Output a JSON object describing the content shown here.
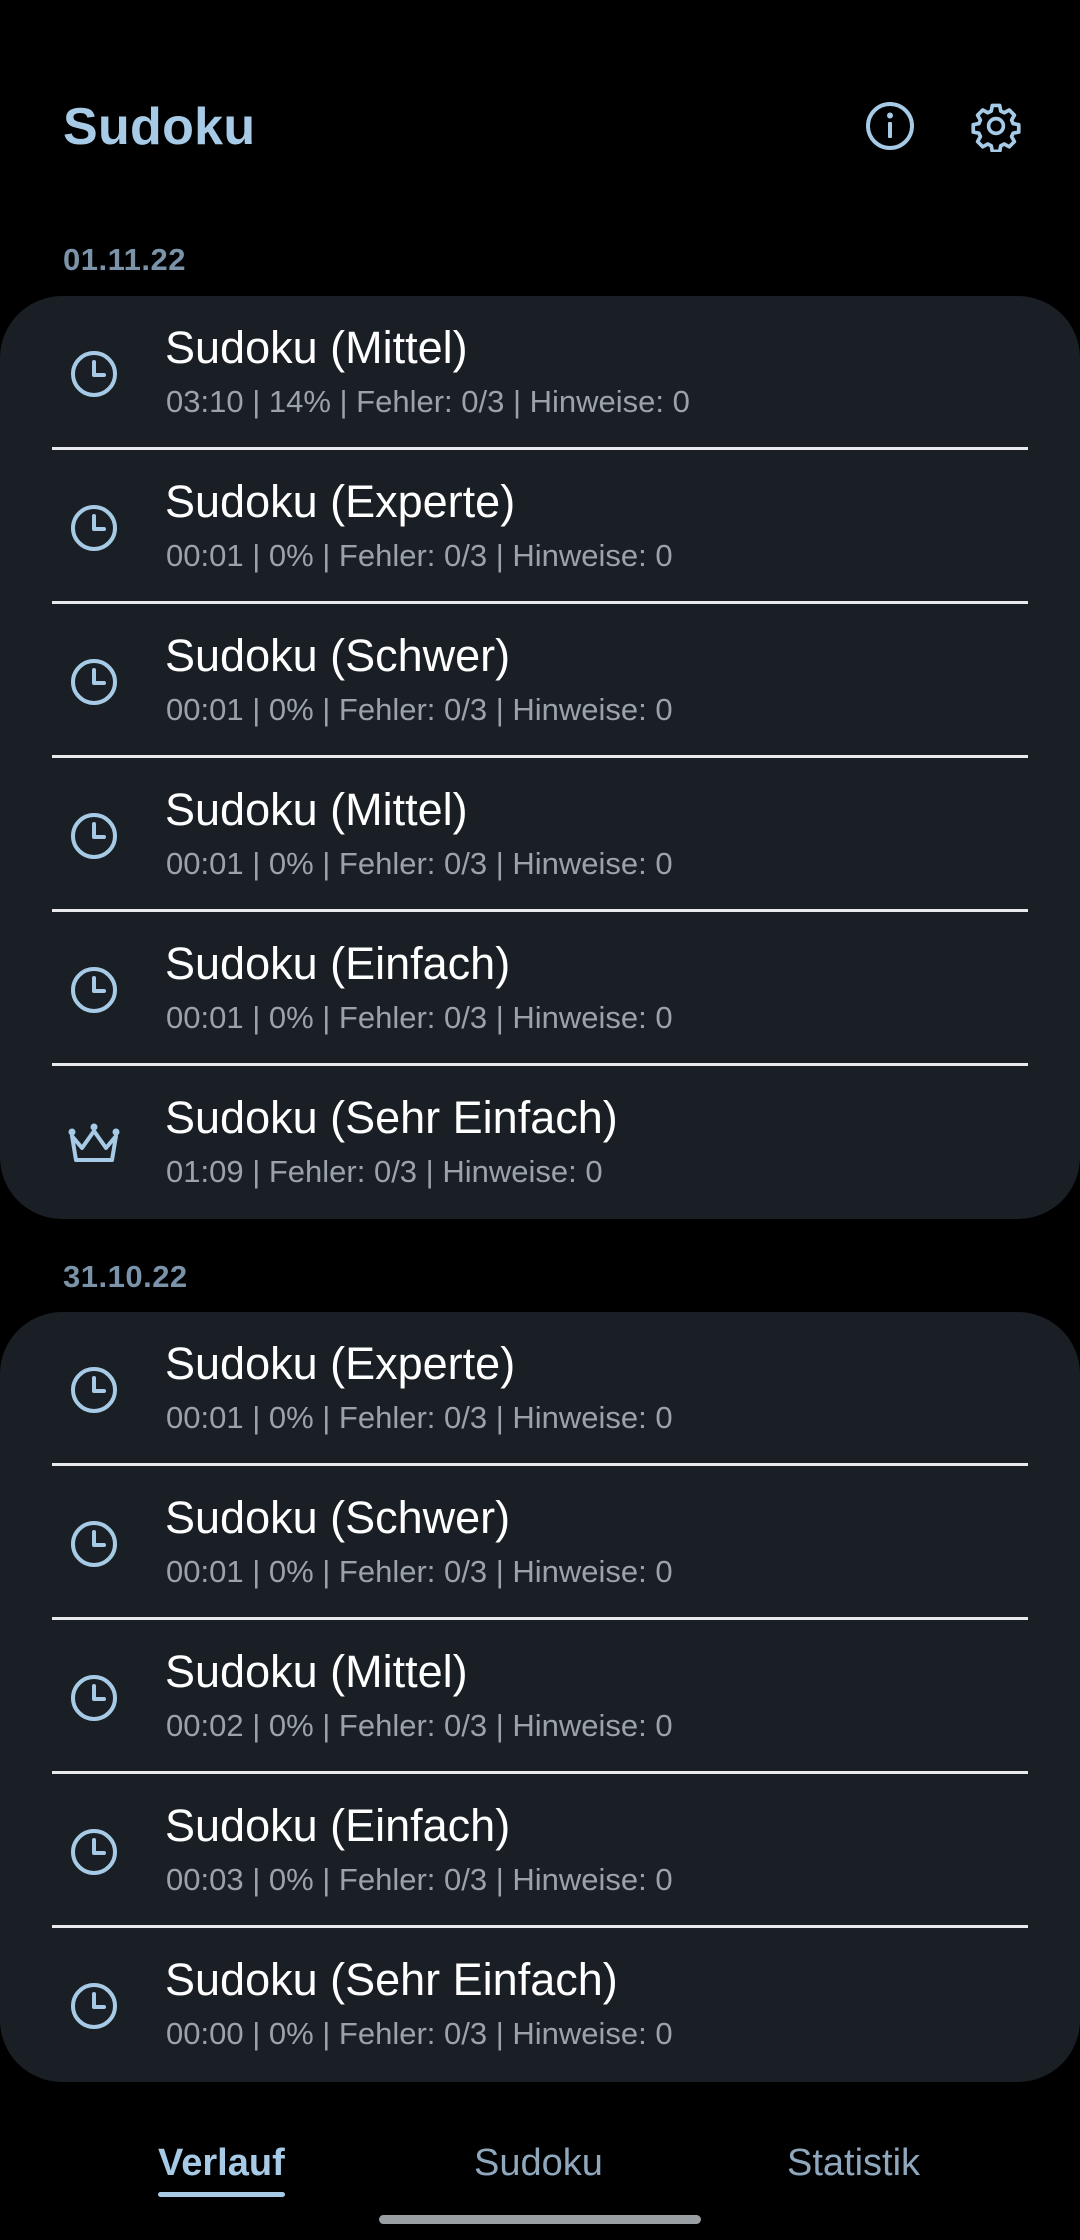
{
  "app": {
    "title": "Sudoku",
    "accent_color": "#a7cbe6"
  },
  "toolbar": {
    "info_icon": "info-icon",
    "settings_icon": "gear-icon"
  },
  "groups": [
    {
      "date": "01.11.22",
      "items": [
        {
          "icon": "clock-icon",
          "title": "Sudoku (Mittel)",
          "subtitle": "03:10 | 14% | Fehler: 0/3 | Hinweise: 0"
        },
        {
          "icon": "clock-icon",
          "title": "Sudoku (Experte)",
          "subtitle": "00:01 | 0% | Fehler: 0/3 | Hinweise: 0"
        },
        {
          "icon": "clock-icon",
          "title": "Sudoku (Schwer)",
          "subtitle": "00:01 | 0% | Fehler: 0/3 | Hinweise: 0"
        },
        {
          "icon": "clock-icon",
          "title": "Sudoku (Mittel)",
          "subtitle": "00:01 | 0% | Fehler: 0/3 | Hinweise: 0"
        },
        {
          "icon": "clock-icon",
          "title": "Sudoku (Einfach)",
          "subtitle": "00:01 | 0% | Fehler: 0/3 | Hinweise: 0"
        },
        {
          "icon": "crown-icon",
          "title": "Sudoku (Sehr Einfach)",
          "subtitle": "01:09 | Fehler: 0/3 | Hinweise: 0"
        }
      ]
    },
    {
      "date": "31.10.22",
      "items": [
        {
          "icon": "clock-icon",
          "title": "Sudoku (Experte)",
          "subtitle": "00:01 | 0% | Fehler: 0/3 | Hinweise: 0"
        },
        {
          "icon": "clock-icon",
          "title": "Sudoku (Schwer)",
          "subtitle": "00:01 | 0% | Fehler: 0/3 | Hinweise: 0"
        },
        {
          "icon": "clock-icon",
          "title": "Sudoku (Mittel)",
          "subtitle": "00:02 | 0% | Fehler: 0/3 | Hinweise: 0"
        },
        {
          "icon": "clock-icon",
          "title": "Sudoku (Einfach)",
          "subtitle": "00:03 | 0% | Fehler: 0/3 | Hinweise: 0"
        },
        {
          "icon": "clock-icon",
          "title": "Sudoku (Sehr Einfach)",
          "subtitle": "00:00 | 0% | Fehler: 0/3 | Hinweise: 0"
        }
      ]
    }
  ],
  "nav": {
    "tabs": [
      {
        "label": "Verlauf",
        "active": true
      },
      {
        "label": "Sudoku",
        "active": false
      },
      {
        "label": "Statistik",
        "active": false
      }
    ]
  }
}
